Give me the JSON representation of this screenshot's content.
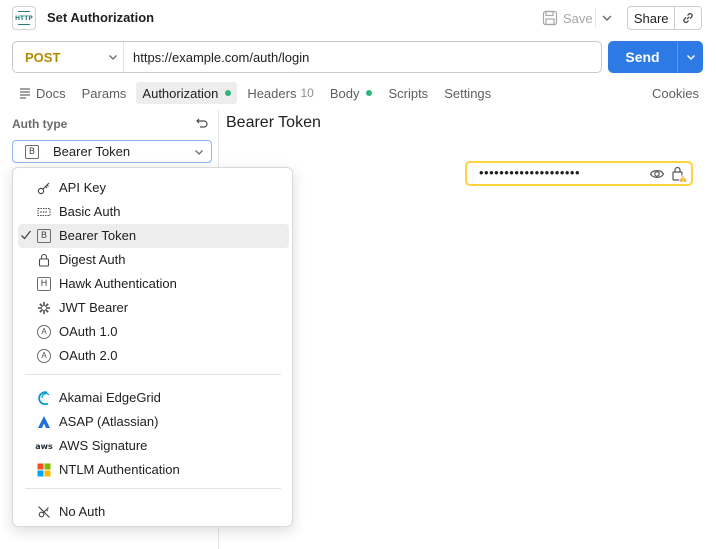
{
  "header": {
    "app_icon_text": "HTTP",
    "title": "Set Authorization",
    "save_label": "Save",
    "share_label": "Share"
  },
  "request": {
    "method": "POST",
    "url": "https://example.com/auth/login",
    "send_label": "Send"
  },
  "tabs": [
    {
      "label": "Docs"
    },
    {
      "label": "Params"
    },
    {
      "label": "Authorization",
      "dot": true,
      "active": true
    },
    {
      "label": "Headers",
      "count": "10"
    },
    {
      "label": "Body",
      "dot": true
    },
    {
      "label": "Scripts"
    },
    {
      "label": "Settings"
    }
  ],
  "cookies_label": "Cookies",
  "auth": {
    "type_label": "Auth type",
    "selected": "Bearer Token",
    "selected_icon_text": "B"
  },
  "right_pane": {
    "title": "Bearer Token",
    "token_masked": "••••••••••••••••••••"
  },
  "menu": {
    "items": [
      {
        "label": "API Key",
        "icon": "key-icon"
      },
      {
        "label": "Basic Auth",
        "icon": "basic-auth-icon"
      },
      {
        "label": "Bearer Token",
        "icon": "bearer-token-icon",
        "icon_text": "B",
        "selected": true
      },
      {
        "label": "Digest Auth",
        "icon": "lock-icon"
      },
      {
        "label": "Hawk Authentication",
        "icon": "hawk-icon",
        "icon_text": "H"
      },
      {
        "label": "JWT Bearer",
        "icon": "jwt-icon"
      },
      {
        "label": "OAuth 1.0",
        "icon": "oauth1-icon",
        "icon_text": "A"
      },
      {
        "label": "OAuth 2.0",
        "icon": "oauth2-icon",
        "icon_text": "A"
      },
      {
        "label": "Akamai EdgeGrid",
        "icon": "akamai-icon"
      },
      {
        "label": "ASAP (Atlassian)",
        "icon": "atlassian-icon"
      },
      {
        "label": "AWS Signature",
        "icon": "aws-icon",
        "icon_text": "aws"
      },
      {
        "label": "NTLM Authentication",
        "icon": "microsoft-icon"
      },
      {
        "label": "No Auth",
        "icon": "no-auth-icon"
      }
    ]
  },
  "colors": {
    "accent": "#2d7ae5",
    "method_post": "#b28c00",
    "status_dot": "#2eb67d",
    "warning": "#ffd33d"
  }
}
